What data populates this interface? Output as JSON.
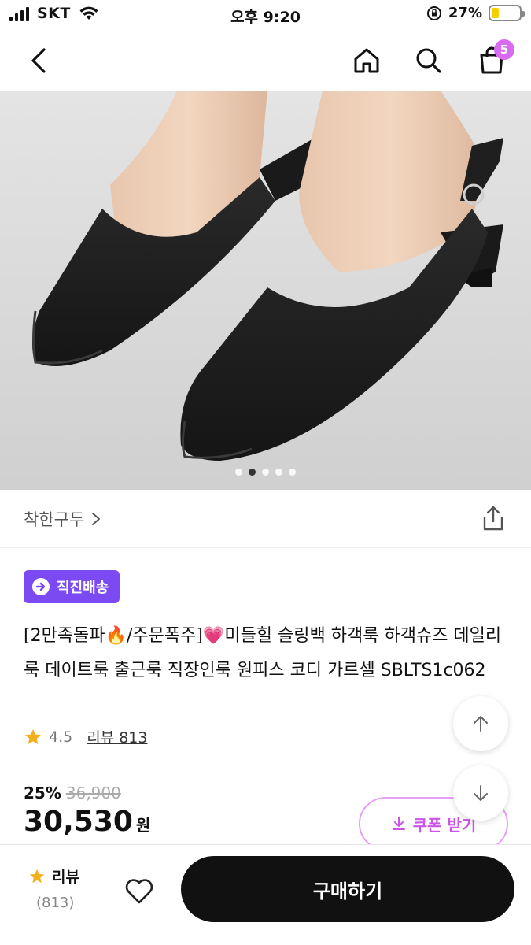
{
  "status_bar": {
    "carrier": "SKT",
    "time": "오후 9:20",
    "battery_percent_text": "27%",
    "battery_level": 0.27
  },
  "header": {
    "back_icon": "chevron-left-icon",
    "home_icon": "home-icon",
    "search_icon": "search-icon",
    "cart_icon": "shopping-bag-icon",
    "cart_count": "5"
  },
  "gallery": {
    "image": "black slingback heels photo",
    "slide_count": 5,
    "active_slide": 2
  },
  "brand": {
    "name": "착한구두"
  },
  "product": {
    "badge": "직진배송",
    "title_parts": [
      "[2만족돌파",
      "🔥",
      "/주문폭주]",
      "💗",
      "미들힐 슬링백 하객룩 하객슈즈 데일리룩 데이트룩 출근룩 직장인룩 원피스 코디 가르셀 SBLTS1c062"
    ],
    "rating": "4.5",
    "review_label": "리뷰 813",
    "discount": "25%",
    "original_price": "36,900",
    "price": "30,530",
    "currency": "원",
    "coupon_label": "쿠폰 받기"
  },
  "bottom_bar": {
    "review_title": "리뷰",
    "review_count": "(813)",
    "buy_label": "구매하기"
  },
  "colors": {
    "accent_purple": "#7b4af2",
    "badge_pink": "#d86bf0",
    "coupon_pink": "#cc55e8",
    "buy_button": "#111111"
  }
}
